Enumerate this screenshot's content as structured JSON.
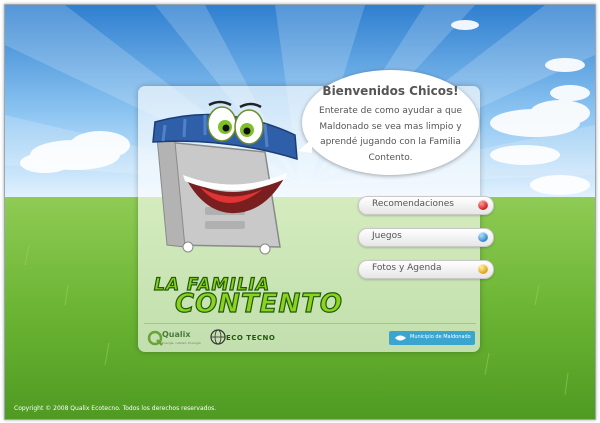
{
  "bubble": {
    "title": "Bienvenidos Chicos!",
    "text": "Enterate de como ayudar a que Maldonado se vea mas limpio  y aprendé jugando con la Familia Contento."
  },
  "menu": [
    {
      "label": "Recomendaciones",
      "dot_color": "red"
    },
    {
      "label": "Juegos",
      "dot_color": "blue"
    },
    {
      "label": "Fotos y Agenda",
      "dot_color": "yellow"
    }
  ],
  "logo": {
    "line1": "LA FAMILIA",
    "line2": "CONTENTO"
  },
  "footer_logos": {
    "qualix": "Qualix",
    "qualix_tagline": "Energía, calidad, Ecología",
    "ecotecno": "ECO TECNO",
    "municipio": "Municipio de Maldonado"
  },
  "copyright": "Copyright © 2008 Qualix Ecotecno. Todos los derechos reservados.",
  "colors": {
    "sky": "#3f8fd8",
    "grass": "#6fb83a",
    "bin_lid": "#2f5fa8",
    "bin_body": "#c9c9c9",
    "municipio_button": "#3aa6d0"
  }
}
